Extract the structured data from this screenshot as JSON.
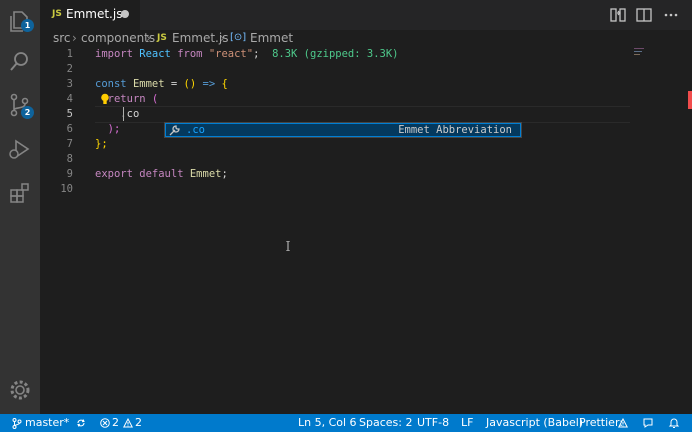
{
  "tab": {
    "file_type": "JS",
    "title": "Emmet.js"
  },
  "breadcrumb": {
    "folder1": "src",
    "folder2": "components",
    "file_type": "JS",
    "file": "Emmet.js",
    "symbol": "Emmet"
  },
  "activity_bar": {
    "explorer_badge": "1",
    "scm_badge": "2",
    "icons": [
      "explorer-icon",
      "search-icon",
      "source-control-icon",
      "run-debug-icon",
      "extensions-icon",
      "settings-gear-icon"
    ]
  },
  "editor": {
    "line_numbers": [
      "1",
      "2",
      "3",
      "4",
      "5",
      "6",
      "7",
      "8",
      "9",
      "10"
    ],
    "line1": {
      "import": "import",
      "React": "React",
      "from": "from",
      "str": "\"react\"",
      "semi": ";",
      "size": "8.3K (gzipped: 3.3K)"
    },
    "line3": {
      "const": "const",
      "name": "Emmet",
      "eq": "=",
      "parens": "()",
      "arrow": "=>",
      "brace": "{"
    },
    "line4": {
      "return": "return",
      "paren": "("
    },
    "line5": {
      "text": ".co"
    },
    "line6": {
      "text": ");"
    },
    "line7": {
      "text": "};"
    },
    "line9": {
      "export": "export",
      "default": "default",
      "name": "Emmet",
      "semi": ";"
    }
  },
  "suggestion": {
    "label": ".co",
    "detail": "Emmet Abbreviation",
    "icon": "wrench-icon"
  },
  "statusbar": {
    "branch": "master*",
    "errors": "2",
    "warnings": "2",
    "position": "Ln 5, Col 6",
    "spaces": "Spaces: 2",
    "encoding": "UTF-8",
    "eol": "LF",
    "language": "Javascript (Babel)",
    "prettier": "Prettier:"
  },
  "colors": {
    "accent": "#007acc",
    "activity_bar": "#333333",
    "editor_bg": "#1e1e1e"
  }
}
